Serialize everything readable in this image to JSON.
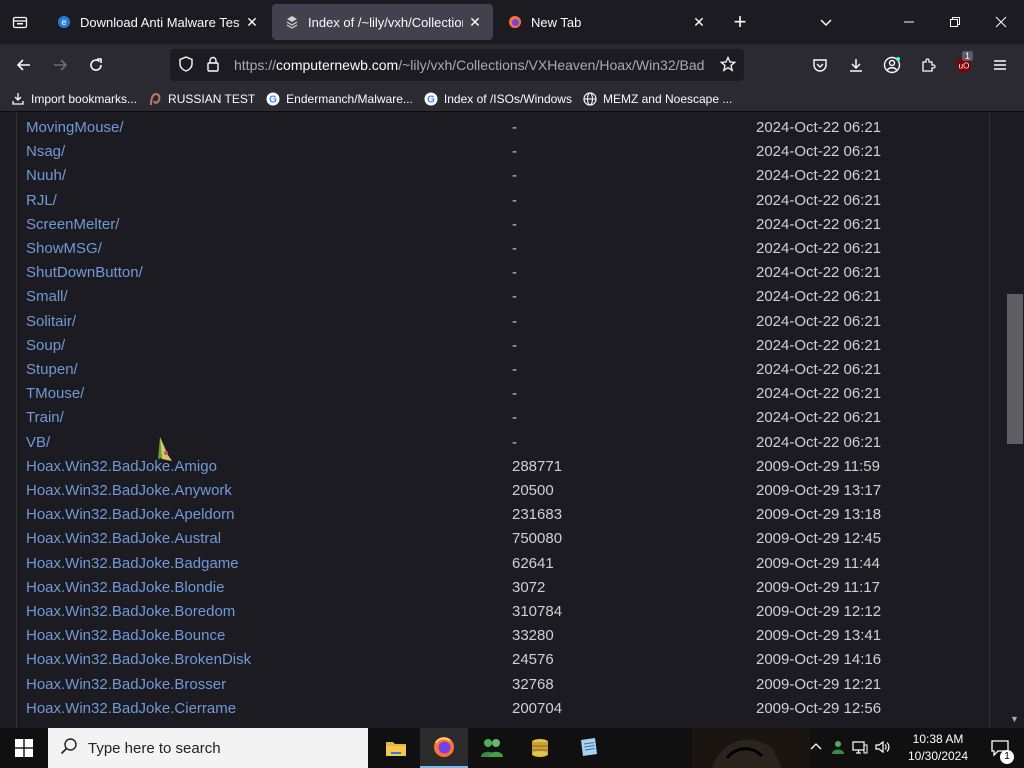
{
  "tabs": [
    {
      "title": "Download Anti Malware Testfile",
      "active": false
    },
    {
      "title": "Index of /~lily/vxh/Collections/",
      "active": true
    },
    {
      "title": "New Tab",
      "active": false
    }
  ],
  "url": {
    "prefix": "https://",
    "host": "computernewb.com",
    "path": "/~lily/vxh/Collections/VXHeaven/Hoax/Win32/Bad"
  },
  "bookmarks": [
    {
      "label": "Import bookmarks...",
      "icon": "import-icon"
    },
    {
      "label": "RUSSIAN TEST",
      "icon": "site-icon"
    },
    {
      "label": "Endermanch/Malware...",
      "icon": "google-icon"
    },
    {
      "label": "Index of /ISOs/Windows",
      "icon": "google-icon"
    },
    {
      "label": "MEMZ and Noescape ...",
      "icon": "globe-icon"
    }
  ],
  "extensions_badge": "1",
  "listing": [
    {
      "name": "MovingMouse/",
      "size": "-",
      "date": "2024-Oct-22 06:21"
    },
    {
      "name": "Nsag/",
      "size": "-",
      "date": "2024-Oct-22 06:21"
    },
    {
      "name": "Nuuh/",
      "size": "-",
      "date": "2024-Oct-22 06:21"
    },
    {
      "name": "RJL/",
      "size": "-",
      "date": "2024-Oct-22 06:21"
    },
    {
      "name": "ScreenMelter/",
      "size": "-",
      "date": "2024-Oct-22 06:21"
    },
    {
      "name": "ShowMSG/",
      "size": "-",
      "date": "2024-Oct-22 06:21"
    },
    {
      "name": "ShutDownButton/",
      "size": "-",
      "date": "2024-Oct-22 06:21"
    },
    {
      "name": "Small/",
      "size": "-",
      "date": "2024-Oct-22 06:21"
    },
    {
      "name": "Solitair/",
      "size": "-",
      "date": "2024-Oct-22 06:21"
    },
    {
      "name": "Soup/",
      "size": "-",
      "date": "2024-Oct-22 06:21"
    },
    {
      "name": "Stupen/",
      "size": "-",
      "date": "2024-Oct-22 06:21"
    },
    {
      "name": "TMouse/",
      "size": "-",
      "date": "2024-Oct-22 06:21"
    },
    {
      "name": "Train/",
      "size": "-",
      "date": "2024-Oct-22 06:21"
    },
    {
      "name": "VB/",
      "size": "-",
      "date": "2024-Oct-22 06:21"
    },
    {
      "name": "Hoax.Win32.BadJoke.Amigo",
      "size": "288771",
      "date": "2009-Oct-29 11:59"
    },
    {
      "name": "Hoax.Win32.BadJoke.Anywork",
      "size": "20500",
      "date": "2009-Oct-29 13:17"
    },
    {
      "name": "Hoax.Win32.BadJoke.Apeldorn",
      "size": "231683",
      "date": "2009-Oct-29 13:18"
    },
    {
      "name": "Hoax.Win32.BadJoke.Austral",
      "size": "750080",
      "date": "2009-Oct-29 12:45"
    },
    {
      "name": "Hoax.Win32.BadJoke.Badgame",
      "size": "62641",
      "date": "2009-Oct-29 11:44"
    },
    {
      "name": "Hoax.Win32.BadJoke.Blondie",
      "size": "3072",
      "date": "2009-Oct-29 11:17"
    },
    {
      "name": "Hoax.Win32.BadJoke.Boredom",
      "size": "310784",
      "date": "2009-Oct-29 12:12"
    },
    {
      "name": "Hoax.Win32.BadJoke.Bounce",
      "size": "33280",
      "date": "2009-Oct-29 13:41"
    },
    {
      "name": "Hoax.Win32.BadJoke.BrokenDisk",
      "size": "24576",
      "date": "2009-Oct-29 14:16"
    },
    {
      "name": "Hoax.Win32.BadJoke.Brosser",
      "size": "32768",
      "date": "2009-Oct-29 12:21"
    },
    {
      "name": "Hoax.Win32.BadJoke.Cierrame",
      "size": "200704",
      "date": "2009-Oct-29 12:56"
    }
  ],
  "taskbar": {
    "search_placeholder": "Type here to search",
    "time": "10:38 AM",
    "date": "10/30/2024",
    "notification_count": "1"
  }
}
